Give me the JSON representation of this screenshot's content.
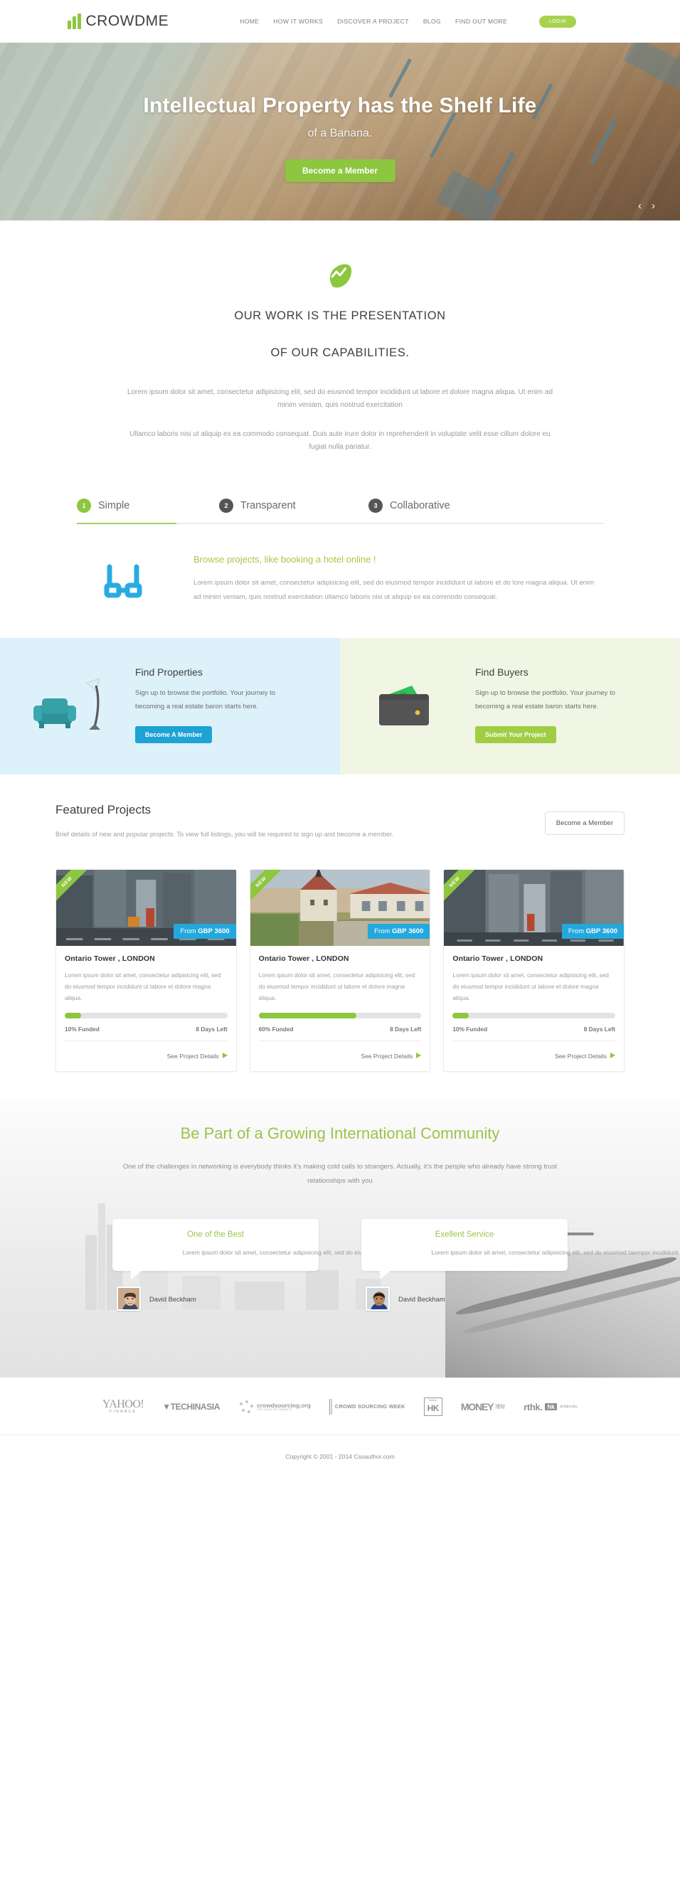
{
  "header": {
    "logo_text": "CROWDME",
    "nav": [
      {
        "label": "HOME"
      },
      {
        "label": "HOW IT WORKS"
      },
      {
        "label": "DISCOVER A PROJECT"
      },
      {
        "label": "BLOG"
      },
      {
        "label": "FIND OUT MORE"
      }
    ],
    "login_label": "LOGIN"
  },
  "hero": {
    "title": "Intellectual Property has the Shelf Life",
    "subtitle": "of a Banana.",
    "cta_label": "Become a Member",
    "prev_icon": "‹",
    "next_icon": "›"
  },
  "intro": {
    "heading_line1": "OUR WORK IS THE PRESENTATION",
    "heading_line2": "OF OUR CAPABILITIES.",
    "paragraph1": "Lorem ipsum dolor sit amet, consectetur adipisicing elit, sed do eiusmod tempor incididunt ut labore et dolore magna aliqua. Ut enim ad minim veniam, quis nostrud exercitation",
    "paragraph2": "Ullamco laboris nisi ut aliquip ex ea commodo consequat. Duis aute irure dolor in reprehenderit in voluptate velit esse cillum dolore eu fugiat nulla pariatur."
  },
  "tabs": [
    {
      "num": "1",
      "label": "Simple"
    },
    {
      "num": "2",
      "label": "Transparent"
    },
    {
      "num": "3",
      "label": "Collaborative"
    }
  ],
  "panel": {
    "title": "Browse projects, like booking a hotel online !",
    "body": "Lorem ipsum dolor sit amet, consectetur adipisicing elit, sed do eiusmod tempor incididunt ut labore et do lore magna aliqua. Ut enim ad minim veniam, quis nostrud exercitation ullamco laboris nisi ut aliquip ex ea commodo consequat."
  },
  "duo": {
    "left": {
      "title": "Find Properties",
      "body": "Sign up to browse the portfolio. Your journey to becoming a real estate baron starts here.",
      "button": "Become A Member",
      "accent": "#1fa2d6",
      "bg": "#ddf1fb"
    },
    "right": {
      "title": "Find Buyers",
      "body": "Sign up to browse the portfolio. Your journey to becoming a real estate baron starts here.",
      "button": "Submit Your Project",
      "accent": "#a0cd43",
      "bg": "#f1f6e4"
    }
  },
  "featured": {
    "title": "Featured Projects",
    "subtitle": "Brief details of new and popular projects. To view full listings, you will be required to sign up and become a member.",
    "button": "Become a Member",
    "cards": [
      {
        "badge": "NEW",
        "price_prefix": "From",
        "price_currency": "GBP",
        "price_value": "3600",
        "title": "Ontario Tower , LONDON",
        "body": "Lorem ipsum dolor sit amet, consectetur adipisicing elit, sed do eiusmod tempor incididunt ut labore et dolore magna aliqua.",
        "funded": "10% Funded",
        "progress": 10,
        "days": "8 Days Left",
        "link": "See Project Details"
      },
      {
        "badge": "NEW",
        "price_prefix": "From",
        "price_currency": "GBP",
        "price_value": "3600",
        "title": "Ontario Tower , LONDON",
        "body": "Lorem ipsum dolor sit amet, consectetur adipisicing elit, sed do eiusmod tempor incididunt ut labore et dolore magna aliqua.",
        "funded": "60% Funded",
        "progress": 60,
        "days": "8 Days Left",
        "link": "See Project Details"
      },
      {
        "badge": "NEW",
        "price_prefix": "From",
        "price_currency": "GBP",
        "price_value": "3600",
        "title": "Ontario Tower , LONDON",
        "body": "Lorem ipsum dolor sit amet, consectetur adipisicing elit, sed do eiusmod tempor incididunt ut labore et dolore magna aliqua.",
        "funded": "10% Funded",
        "progress": 10,
        "days": "8 Days Left",
        "link": "See Project Details"
      }
    ]
  },
  "community": {
    "title": "Be Part of a Growing International Community",
    "subtitle": "One of the challenges in networking is everybody thinks it's making cold calls to strangers. Actually, it's the people who already have strong trust relationships with you",
    "testimonials": [
      {
        "title": "One of the Best",
        "body": "Lorem ipsum dolor sit amet, consectetur adipisicing elit, sed do eiusmod taempor incididunt ut labore et dolore magna aliqua.",
        "author": "David Beckham"
      },
      {
        "title": "Exellent Service",
        "body": "Lorem ipsum dolor sit amet, consectetur adipisicing elit, sed do eiusmod taempor incididunt ut labore et dolore magna aliqua.",
        "author": "David Beckham"
      }
    ]
  },
  "partners": [
    {
      "name": "YAHOO!",
      "sub": "FINANCE"
    },
    {
      "name": "TECHINASIA",
      "sub": ""
    },
    {
      "name": "crowdsourcing.org",
      "sub": "THE INDUSTRY WEBSITE"
    },
    {
      "name": "CROWD SOURCING WEEK",
      "sub": ""
    },
    {
      "name": "HK",
      "sub": "Startup"
    },
    {
      "name": "MONEY",
      "sub": "理財"
    },
    {
      "name": "rthk.hk",
      "sub": "香港電台網站"
    }
  ],
  "footer": {
    "copyright": "Copyright © 2001 - 2014  Cssauthor.com"
  },
  "colors": {
    "brand_green": "#8dc63f",
    "blue": "#23a8dd",
    "text_dark": "#3f3f3f",
    "text_muted": "#9a9a9a"
  }
}
